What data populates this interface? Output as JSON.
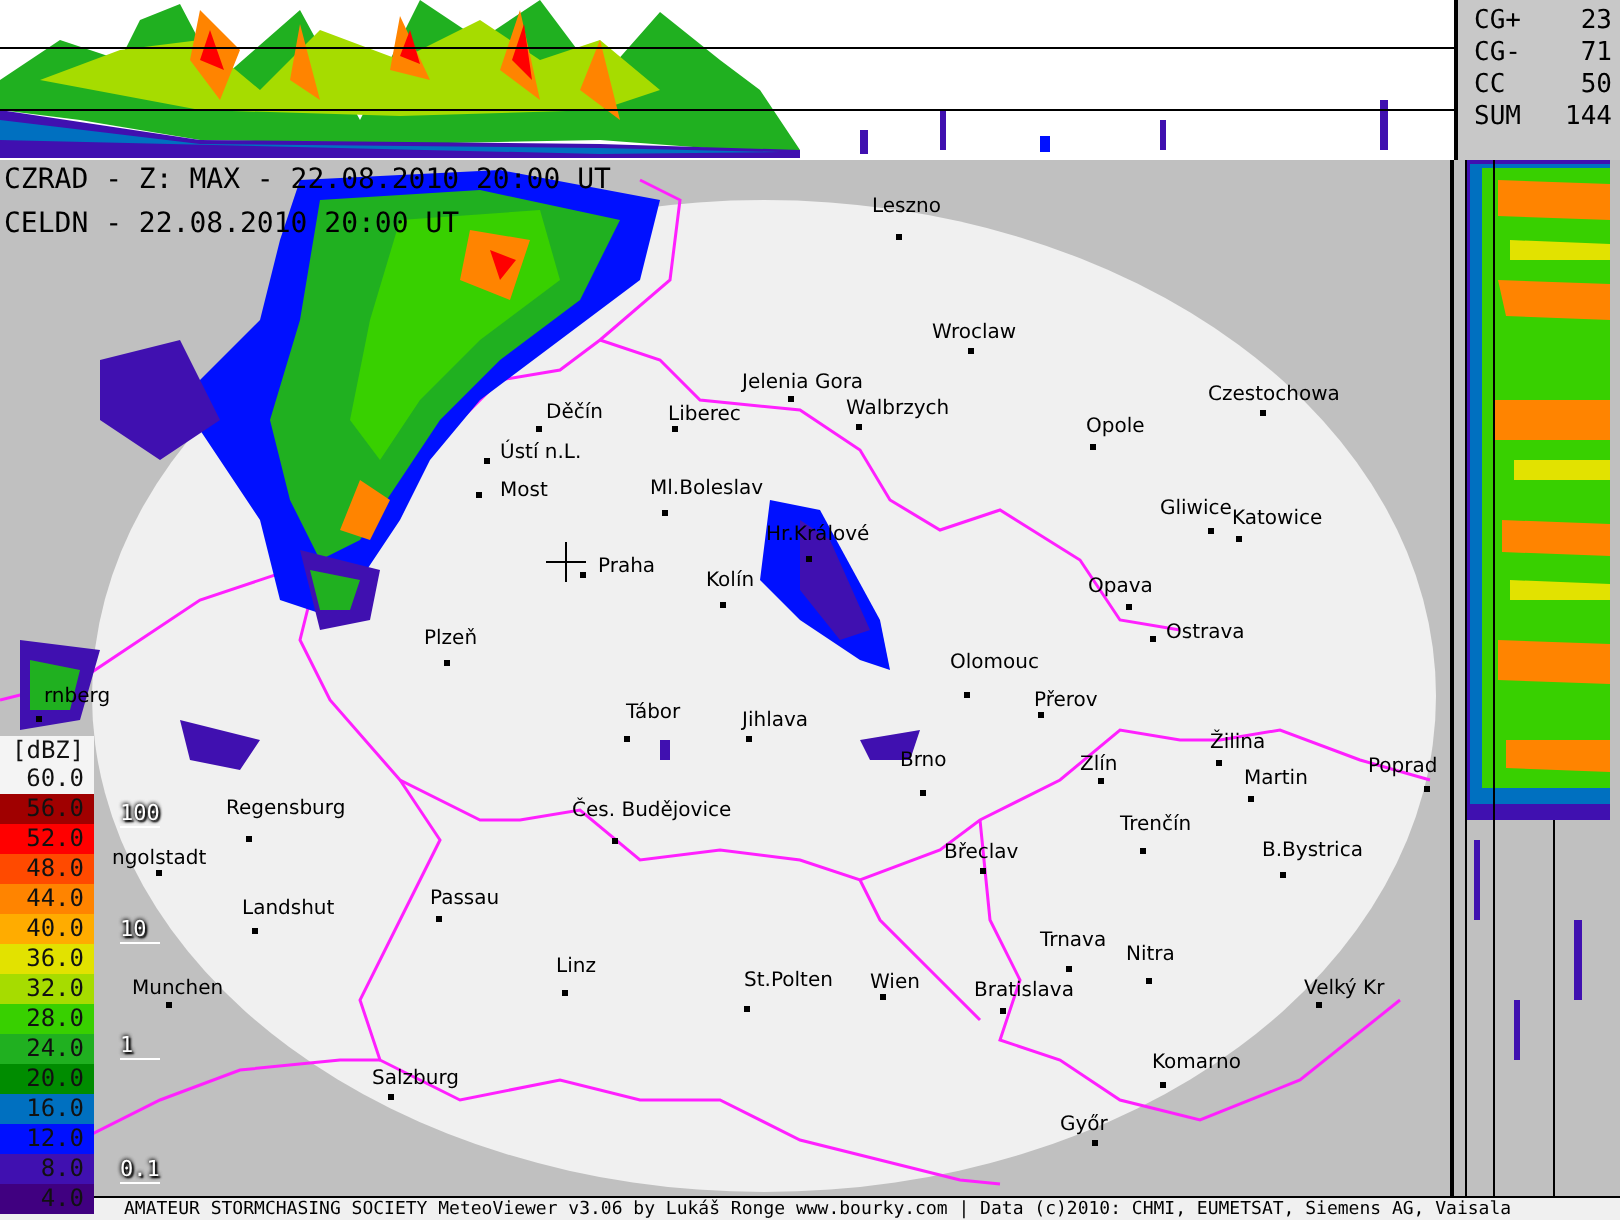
{
  "header": {
    "radar_line": "CZRAD - Z: MAX - 22.08.2010 20:00 UT",
    "lightning_line": "CELDN - 22.08.2010 20:00 UT"
  },
  "lightning_counts": [
    {
      "label": "CG+",
      "value": "23"
    },
    {
      "label": "CG-",
      "value": "71"
    },
    {
      "label": "CC",
      "value": "50"
    },
    {
      "label": "SUM",
      "value": "144"
    }
  ],
  "legend": {
    "title": "[dBZ]",
    "items": [
      {
        "label": "60.0",
        "color": "#f4f4f4"
      },
      {
        "label": "56.0",
        "color": "#a00000"
      },
      {
        "label": "52.0",
        "color": "#ff0000"
      },
      {
        "label": "48.0",
        "color": "#ff4a00"
      },
      {
        "label": "44.0",
        "color": "#ff8400"
      },
      {
        "label": "40.0",
        "color": "#ffac00"
      },
      {
        "label": "36.0",
        "color": "#e2e200"
      },
      {
        "label": "32.0",
        "color": "#a6dc00"
      },
      {
        "label": "28.0",
        "color": "#38d000"
      },
      {
        "label": "24.0",
        "color": "#20b020"
      },
      {
        "label": "20.0",
        "color": "#008c00"
      },
      {
        "label": "16.0",
        "color": "#0070c0"
      },
      {
        "label": "12.0",
        "color": "#0010ff"
      },
      {
        "label": "8.0",
        "color": "#4010b0"
      },
      {
        "label": "4.0",
        "color": "#400080"
      }
    ]
  },
  "scale_marks": [
    "100",
    "10",
    "1",
    "0.1"
  ],
  "cities": [
    "Leszno",
    "Wroclaw",
    "Jelenia Gora",
    "Walbrzych",
    "Opole",
    "Czestochowa",
    "Děčín",
    "Liberec",
    "Ústí n.L.",
    "Most",
    "Ml.Boleslav",
    "Gliwice",
    "Katowice",
    "Hr.Králové",
    "Praha",
    "Kolín",
    "Opava",
    "Ostrava",
    "Plzeň",
    "Olomouc",
    "Přerov",
    "Tábor",
    "Jihlava",
    "Žilina",
    "Brno",
    "Zlín",
    "Martin",
    "Poprad",
    "rnberg",
    "Regensburg",
    "ngolstadt",
    "Čes. Budějovice",
    "Trenčín",
    "Břeclav",
    "B.Bystrica",
    "Landshut",
    "Passau",
    "Trnava",
    "Nitra",
    "Munchen",
    "Linz",
    "St.Polten",
    "Wien",
    "Bratislava",
    "Velký Kr",
    "Salzburg",
    "Komarno",
    "Győr"
  ],
  "status_bar": "AMATEUR STORMCHASING SOCIETY MeteoViewer v3.06 by Lukáš Ronge www.bourky.com | Data (c)2010: CHMI, EUMETSAT, Siemens AG, Vaisala"
}
